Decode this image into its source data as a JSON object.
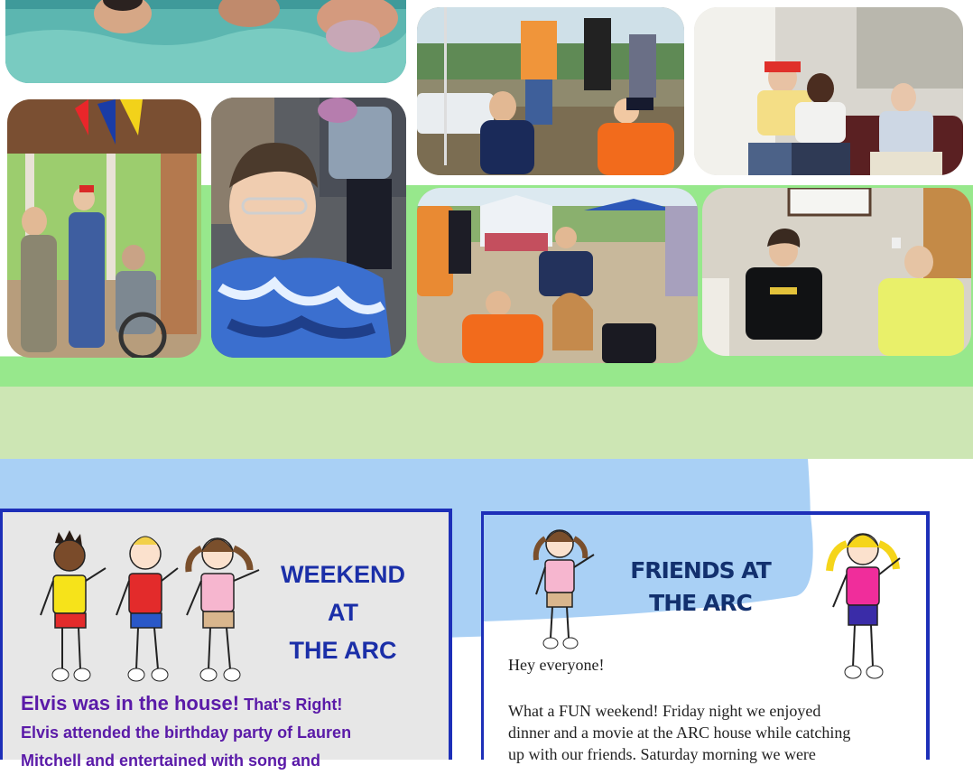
{
  "colors": {
    "green_band": "#97e88c",
    "pale_green_band": "#cde6b4",
    "blue_blob": "#a9d0f5",
    "panel_border": "#1d2fb8",
    "left_panel_bg": "#e7e7e7",
    "title_blue": "#1b2fa8",
    "friends_title": "#12306e",
    "story_purple": "#5a1aa8",
    "body_text": "#222222"
  },
  "photos": [
    {
      "name": "pool-photo",
      "subject": "swimming pool"
    },
    {
      "name": "picnic-photo",
      "subject": "outdoor picnic"
    },
    {
      "name": "living-room-photo",
      "subject": "friends on couch"
    },
    {
      "name": "porch-photo",
      "subject": "porch with flags"
    },
    {
      "name": "tie-dye-photo",
      "subject": "smiling friend in tie-dye"
    },
    {
      "name": "festival-photo",
      "subject": "outdoor festival tents"
    },
    {
      "name": "office-photo",
      "subject": "two friends sitting"
    }
  ],
  "left_panel": {
    "title_line1": "WEEKEND",
    "title_line2": "AT",
    "title_line3": "THE ARC",
    "lead": "Elvis was in the house!",
    "lead_tail": "That's Right!",
    "line2": "Elvis attended the birthday party of Lauren",
    "line3": "Mitchell and entertained with song and"
  },
  "right_panel": {
    "title_line1": "FRIENDS AT",
    "title_line2": "THE ARC",
    "greeting": "Hey everyone!",
    "para_line1": "What a FUN weekend! Friday night we enjoyed",
    "para_line2": "dinner and a movie at the ARC house while catching",
    "para_line3": "up with our friends. Saturday morning we were"
  }
}
